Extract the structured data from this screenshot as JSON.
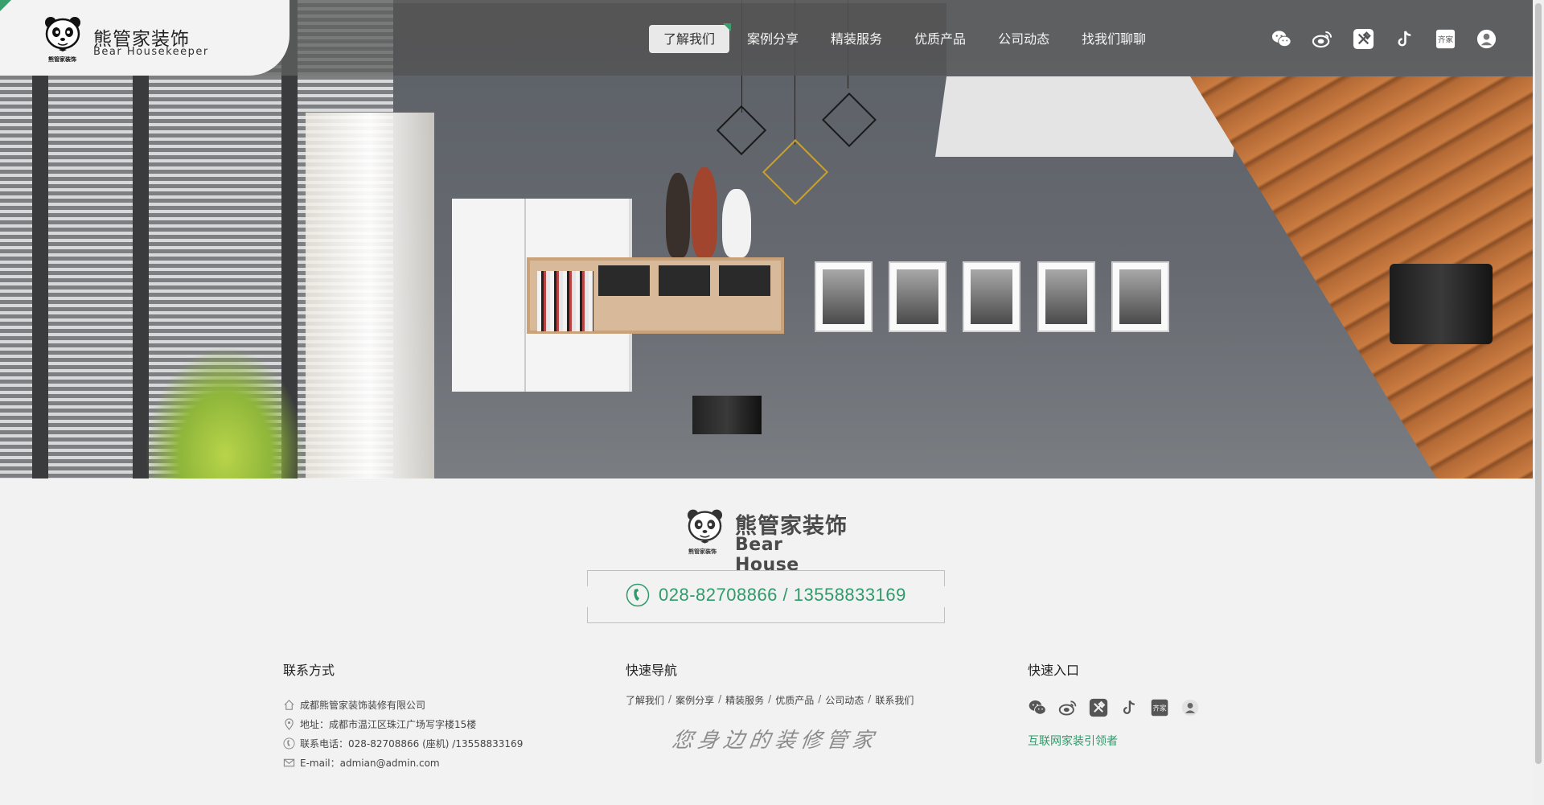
{
  "header": {
    "logo_cn": "熊管家装饰",
    "logo_en": "Bear Housekeeper",
    "logo_badge": "熊管家装饰",
    "nav": [
      {
        "label": "了解我们",
        "active": true
      },
      {
        "label": "案例分享",
        "active": false
      },
      {
        "label": "精装服务",
        "active": false
      },
      {
        "label": "优质产品",
        "active": false
      },
      {
        "label": "公司动态",
        "active": false
      },
      {
        "label": "找我们聊聊",
        "active": false
      }
    ],
    "socials": [
      "wechat-icon",
      "weibo-icon",
      "tool-icon",
      "tiktok-icon",
      "qijia-icon",
      "person-icon"
    ],
    "qijia_text": "齐家"
  },
  "footer": {
    "logo_cn": "熊管家装饰",
    "logo_en": "Bear House",
    "logo_badge": "熊管家装饰",
    "phone": "028-82708866 / 13558833169",
    "contact": {
      "title": "联系方式",
      "company": "成都熊管家装饰装修有限公司",
      "address": "地址：成都市温江区珠江广场写字楼15楼",
      "tel": "联系电话：028-82708866 (座机)  /13558833169",
      "email": "E-mail：admian@admin.com"
    },
    "quick_nav": {
      "title": "快速导航",
      "links": [
        "了解我们",
        "案例分享",
        "精装服务",
        "优质产品",
        "公司动态",
        "联系我们"
      ],
      "slogan": "您身边的装修管家"
    },
    "quick_entry": {
      "title": "快速入口",
      "tagline": "互联网家装引领者",
      "icons": [
        "wechat-icon",
        "weibo-icon",
        "tool-icon",
        "tiktok-icon",
        "qijia-icon",
        "person-icon"
      ]
    }
  },
  "colors": {
    "accent": "#2f9a6a",
    "header_bg": "#5f5f5f",
    "footer_bg": "#f2f2f2"
  }
}
